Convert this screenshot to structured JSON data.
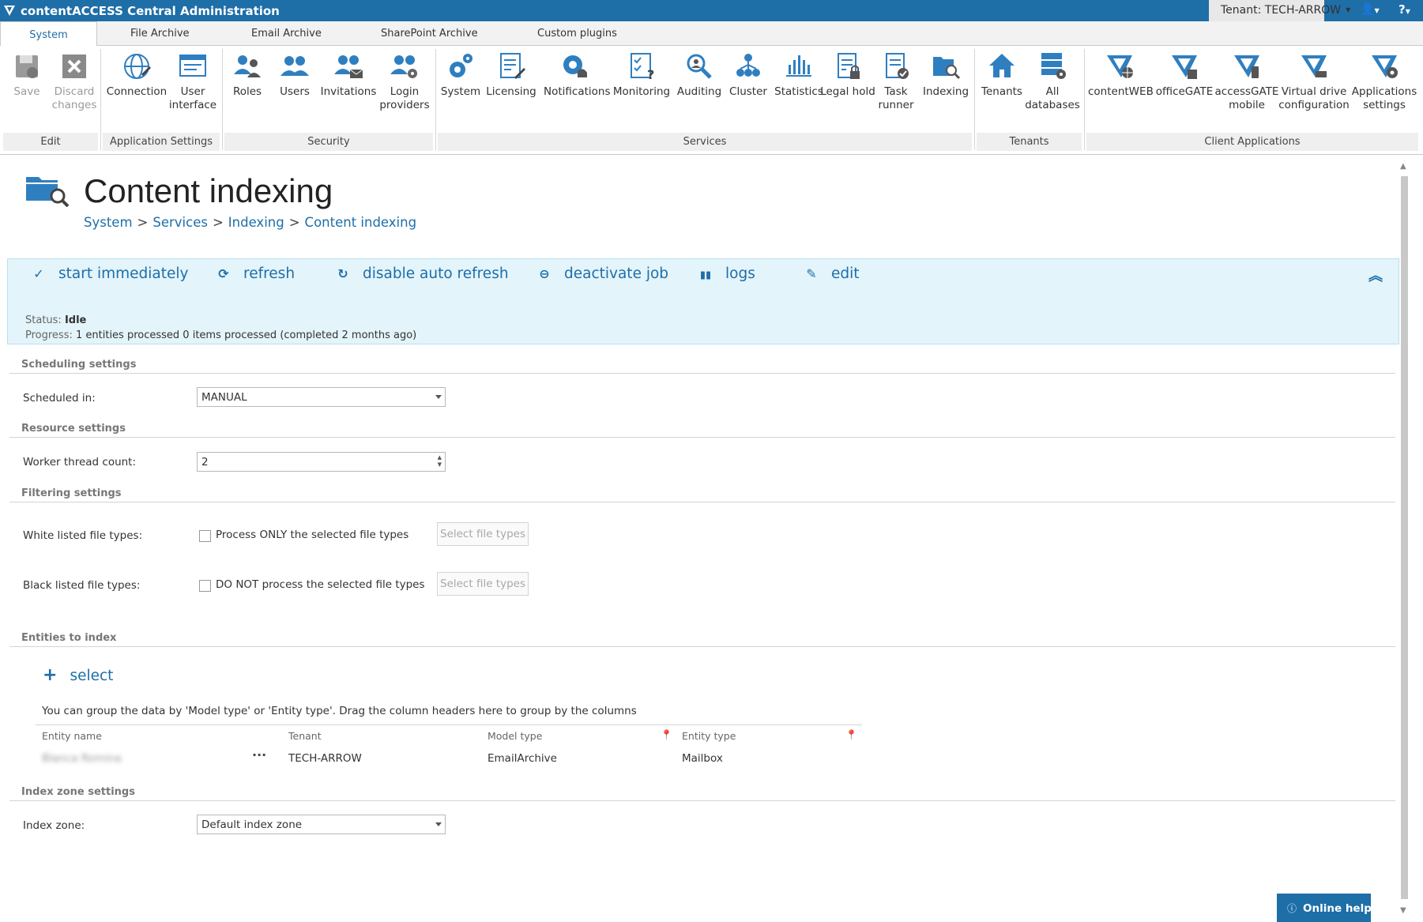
{
  "app": {
    "title": "contentACCESS Central Administration",
    "tenant": "Tenant: TECH-ARROW"
  },
  "tabs": [
    "System",
    "File Archive",
    "Email Archive",
    "SharePoint Archive",
    "Custom plugins"
  ],
  "ribbon": {
    "edit": {
      "label": "Edit",
      "save": "Save",
      "discard": "Discard changes"
    },
    "appsettings": {
      "label": "Application Settings",
      "connection": "Connection",
      "ui": "User interface"
    },
    "security": {
      "label": "Security",
      "roles": "Roles",
      "users": "Users",
      "invitations": "Invitations",
      "login": "Login providers"
    },
    "services": {
      "label": "Services",
      "system": "System",
      "licensing": "Licensing",
      "notifications": "Notifications",
      "monitoring": "Monitoring",
      "auditing": "Auditing",
      "cluster": "Cluster",
      "statistics": "Statistics",
      "legalhold": "Legal hold",
      "taskrunner": "Task runner",
      "indexing": "Indexing"
    },
    "tenants": {
      "label": "Tenants",
      "tenants": "Tenants",
      "alldb": "All databases"
    },
    "clientapps": {
      "label": "Client Applications",
      "contentweb": "contentWEB",
      "officegate": "officeGATE",
      "accessgate": "accessGATE mobile",
      "virtualdrive": "Virtual drive configuration",
      "appsettings": "Applications settings"
    }
  },
  "page": {
    "title": "Content indexing",
    "breadcrumb": [
      "System",
      "Services",
      "Indexing",
      "Content indexing"
    ],
    "breadcrumb_sep": ">"
  },
  "actions": {
    "start": "start immediately",
    "refresh": "refresh",
    "disable_refresh": "disable auto refresh",
    "deactivate": "deactivate job",
    "logs": "logs",
    "edit": "edit",
    "status_label": "Status:",
    "status_value": "Idle",
    "progress_label": "Progress:",
    "progress_value": "1 entities processed 0 items processed (completed 2 months ago)"
  },
  "scheduling": {
    "section": "Scheduling settings",
    "label": "Scheduled in:",
    "value": "MANUAL"
  },
  "resource": {
    "section": "Resource settings",
    "label": "Worker thread count:",
    "value": "2"
  },
  "filtering": {
    "section": "Filtering settings",
    "white_label": "White listed file types:",
    "white_check": "Process ONLY the selected file types",
    "black_label": "Black listed file types:",
    "black_check": "DO NOT process the selected file types",
    "select_btn": "Select file types"
  },
  "entities": {
    "section": "Entities to index",
    "select": "select",
    "group_hint": "You can group the data by 'Model type' or 'Entity type'. Drag the column headers here to group by the columns",
    "columns": [
      "Entity name",
      "Tenant",
      "Model type",
      "Entity type"
    ],
    "rows": [
      {
        "name": "Blanca Romina",
        "tenant": "TECH-ARROW",
        "model": "EmailArchive",
        "type": "Mailbox"
      }
    ]
  },
  "indexzone": {
    "section": "Index zone settings",
    "label": "Index zone:",
    "value": "Default index zone"
  },
  "help": {
    "online_help": "Online help"
  }
}
